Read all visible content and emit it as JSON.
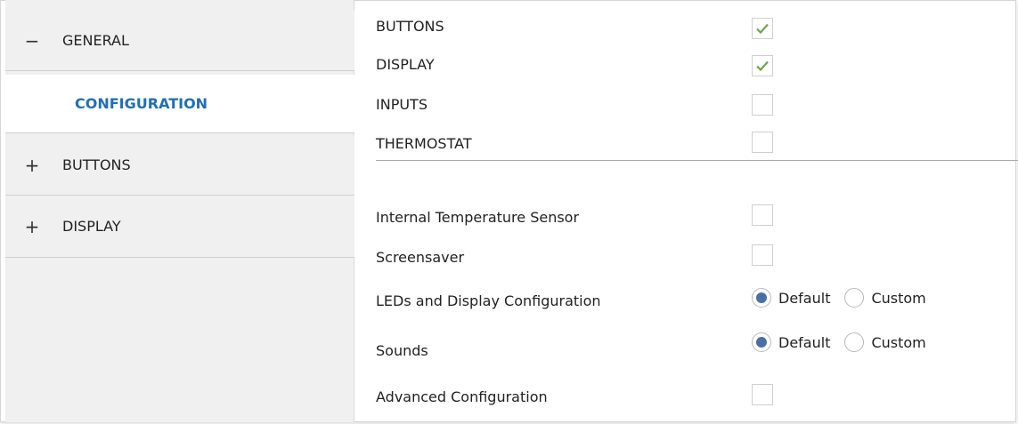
{
  "sidebar": {
    "items": [
      {
        "symbol": "−",
        "label": "GENERAL"
      },
      {
        "label": "CONFIGURATION"
      },
      {
        "symbol": "+",
        "label": "BUTTONS"
      },
      {
        "symbol": "+",
        "label": "DISPLAY"
      }
    ]
  },
  "main": {
    "modules": [
      {
        "label": "BUTTONS",
        "checked": true
      },
      {
        "label": "DISPLAY",
        "checked": true
      },
      {
        "label": "INPUTS",
        "checked": false
      },
      {
        "label": "THERMOSTAT",
        "checked": false
      }
    ],
    "options": {
      "internal_temp": {
        "label": "Internal Temperature Sensor",
        "checked": false
      },
      "screensaver": {
        "label": "Screensaver",
        "checked": false
      },
      "leds": {
        "label": "LEDs and Display Configuration",
        "selected": "Default"
      },
      "sounds": {
        "label": "Sounds",
        "selected": "Default"
      },
      "advanced": {
        "label": "Advanced Configuration",
        "checked": false
      }
    },
    "radio_options": {
      "default": "Default",
      "custom": "Custom"
    }
  },
  "colors": {
    "checkmark": "#6aa84f",
    "accent": "#1f6fb5",
    "radio_selected": "#4a6fa5"
  }
}
